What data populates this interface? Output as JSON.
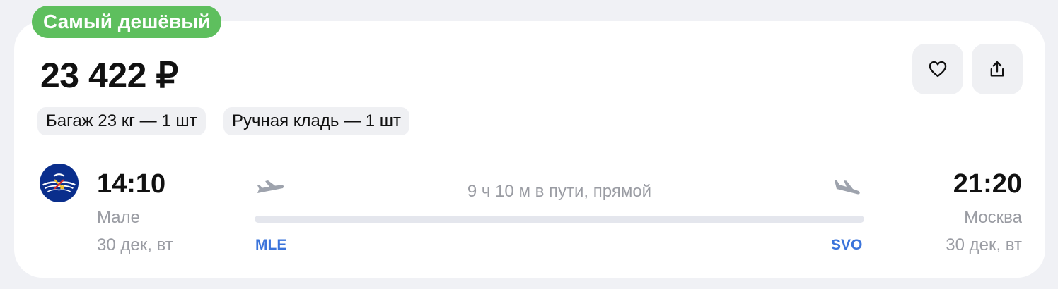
{
  "badge": {
    "label": "Самый дешёвый",
    "color": "#5ebf5e"
  },
  "price": "23 422 ₽",
  "actions": {
    "favorite_icon": "heart-icon",
    "share_icon": "share-icon"
  },
  "baggage": [
    "Багаж 23 кг — 1 шт",
    "Ручная кладь — 1 шт"
  ],
  "airline": {
    "logo_icon": "airline-logo"
  },
  "departure": {
    "time": "14:10",
    "city": "Мале",
    "date": "30 дек, вт",
    "code": "MLE"
  },
  "arrival": {
    "time": "21:20",
    "city": "Москва",
    "date": "30 дек, вт",
    "code": "SVO"
  },
  "duration": "9 ч 10 м в пути, прямой",
  "colors": {
    "accent": "#3b74db",
    "muted": "#9a9ca3",
    "chip_bg": "#eff0f3"
  }
}
